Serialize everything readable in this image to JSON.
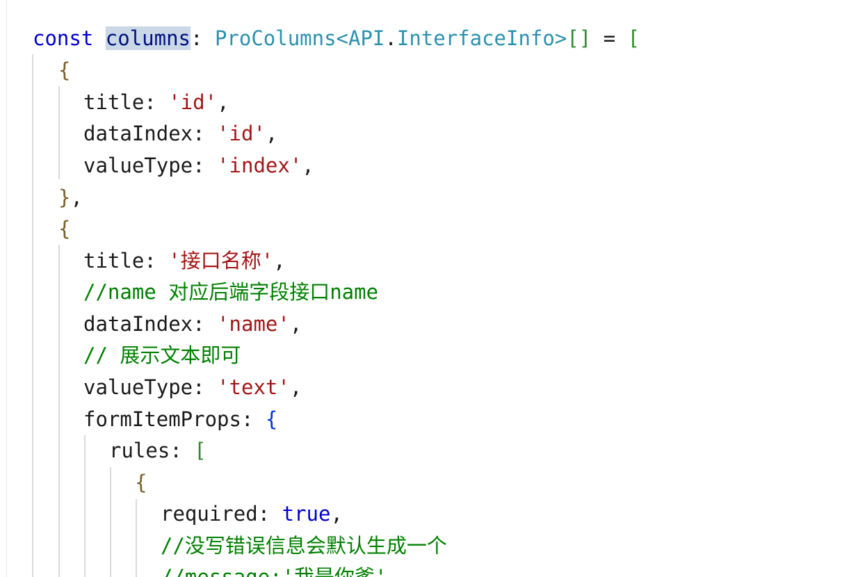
{
  "code": {
    "l1": {
      "kw": "const",
      "name": "columns",
      "colon": ":",
      "type1": "ProColumns",
      "lt": "<",
      "type2": "API",
      "dot": ".",
      "type3": "InterfaceInfo",
      "gt": ">",
      "arr": "[]",
      "eq": "=",
      "open": "["
    },
    "l2": {
      "brace": "{"
    },
    "l3": {
      "key": "title",
      "colon": ":",
      "val": "'id'",
      "comma": ","
    },
    "l4": {
      "key": "dataIndex",
      "colon": ":",
      "val": "'id'",
      "comma": ","
    },
    "l5": {
      "key": "valueType",
      "colon": ":",
      "val": "'index'",
      "comma": ","
    },
    "l6": {
      "brace": "}",
      "comma": ","
    },
    "l7": {
      "brace": "{"
    },
    "l8": {
      "key": "title",
      "colon": ":",
      "val": "'接口名称'",
      "comma": ","
    },
    "l9": {
      "comment": "//name 对应后端字段接口name"
    },
    "l10": {
      "key": "dataIndex",
      "colon": ":",
      "val": "'name'",
      "comma": ","
    },
    "l11": {
      "comment": "// 展示文本即可"
    },
    "l12": {
      "key": "valueType",
      "colon": ":",
      "val": "'text'",
      "comma": ","
    },
    "l13": {
      "key": "formItemProps",
      "colon": ":",
      "brace": "{"
    },
    "l14": {
      "key": "rules",
      "colon": ":",
      "bracket": "["
    },
    "l15": {
      "brace": "{"
    },
    "l16": {
      "key": "required",
      "colon": ":",
      "val": "true",
      "comma": ","
    },
    "l17": {
      "comment": "//没写错误信息会默认生成一个"
    },
    "l18": {
      "comment": "//message:'我是你爹'"
    }
  }
}
